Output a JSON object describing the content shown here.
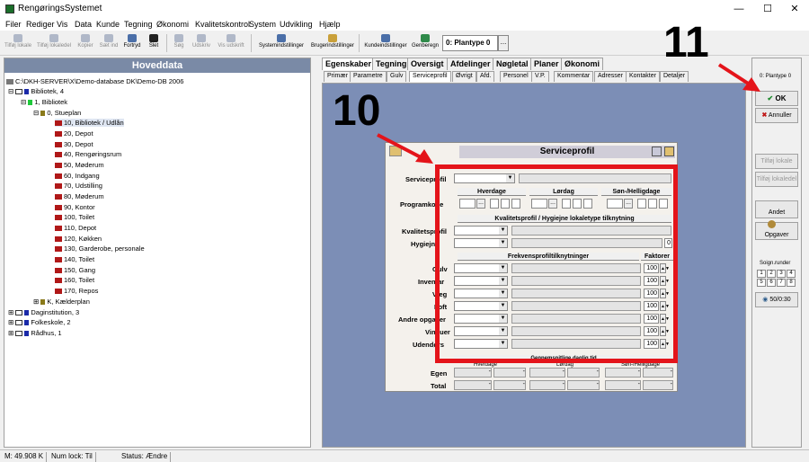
{
  "window": {
    "title": "RengøringsSystemet"
  },
  "menu": [
    "Filer",
    "Rediger",
    "Vis",
    "Data",
    "Kunde",
    "Tegning",
    "Økonomi",
    "Kvalitetskontrol",
    "System",
    "Udvikling",
    "Hjælp"
  ],
  "toolbar": {
    "buttons": [
      {
        "label": "Tilføj lokale"
      },
      {
        "label": "Tilføj lokaledel"
      },
      {
        "label": "Kopier"
      },
      {
        "label": "Sæt ind"
      },
      {
        "label": "Fortryd"
      },
      {
        "label": "Slet"
      },
      {
        "label": "Søg"
      },
      {
        "label": "Udskriv"
      },
      {
        "label": "Vis udskrift"
      },
      {
        "label": "Systemindstillinger"
      },
      {
        "label": "Brugerindstillinger"
      },
      {
        "label": "Kundeindstillinger"
      },
      {
        "label": "Genberegn"
      }
    ],
    "plantype": "0: Plantype 0",
    "more": "..."
  },
  "left": {
    "heading": "Hoveddata",
    "path": "C:\\DKH-SERVER\\X\\Demo-database DK\\Demo-DB 2006",
    "tree": [
      {
        "text": "Bibliotek, 4"
      },
      {
        "text": "1, Bibliotek"
      },
      {
        "text": "0, Stueplan"
      },
      {
        "text": "10, Bibliotek / Udlån"
      },
      {
        "text": "20, Depot"
      },
      {
        "text": "30, Depot"
      },
      {
        "text": "40, Rengøringsrum"
      },
      {
        "text": "50, Møderum"
      },
      {
        "text": "60, Indgang"
      },
      {
        "text": "70, Udstilling"
      },
      {
        "text": "80, Møderum"
      },
      {
        "text": "90, Kontor"
      },
      {
        "text": "100, Toilet"
      },
      {
        "text": "110, Depot"
      },
      {
        "text": "120, Køkken"
      },
      {
        "text": "130, Garderobe, personale"
      },
      {
        "text": "140, Toilet"
      },
      {
        "text": "150, Gang"
      },
      {
        "text": "160, Toilet"
      },
      {
        "text": "170, Repos"
      },
      {
        "text": "K, Kælderplan"
      },
      {
        "text": "Daginstitution, 3"
      },
      {
        "text": "Folkeskole, 2"
      },
      {
        "text": "Rådhus, 1"
      }
    ]
  },
  "tabs_main": [
    "Egenskaber",
    "Tegning",
    "Oversigt",
    "Afdelinger",
    "Nøgletal",
    "Planer",
    "Økonomi"
  ],
  "tabs_sub": [
    "Primær",
    "Parametre",
    "Gulv",
    "Serviceprofil",
    "Øvrigt",
    "Afd.",
    "Personel",
    "V.P.",
    "Kommentar",
    "Adresser",
    "Kontakter",
    "Detaljer"
  ],
  "form": {
    "title": "Serviceprofil",
    "labels": {
      "serviceprofil": "Serviceprofil",
      "programkode": "Programkode",
      "kvalitetsprofil": "Kvalitetsprofil",
      "hygiejne": "Hygiejne",
      "gulv": "Gulv",
      "inventar": "Inventar",
      "vaeg": "Væg",
      "loft": "Loft",
      "andre": "Andre opgaver",
      "vinduer": "Vinduer",
      "udendors": "Udendørs",
      "egen": "Egen",
      "total": "Total"
    },
    "headers": {
      "hverdage": "Hverdage",
      "lordag": "Lørdag",
      "sonhellig": "Søn-/Helligdage",
      "kvalitet": "Kvalitetsprofil / Hygiejne lokaletype tilknytning",
      "frekvens": "Frekvensprofiltilknytninger",
      "faktorer": "Faktorer",
      "gennemsnit": "Gennemsnitlige daglig tid",
      "hverdage2": "Hverdage",
      "lordag2": "Lørdag",
      "sonhellig2": "Søn-/Helligdage"
    },
    "hygiejne_value": "0",
    "factors": [
      "100",
      "100",
      "100",
      "100",
      "100",
      "100",
      "100"
    ],
    "dash": "-",
    "dots": "..."
  },
  "right": {
    "plantype": "0: Plantype 0",
    "ok": "OK",
    "cancel": "Annuller",
    "add_lokale": "Tilføj lokale",
    "add_lokaledel": "Tilføj lokaledel",
    "andet": "Andet",
    "opgaver": "Opgaver",
    "soign_label": "Soign.runder",
    "grid": [
      "1",
      "2",
      "3",
      "4",
      "5",
      "6",
      "7",
      "8"
    ],
    "time": "50/0:30"
  },
  "annotations": {
    "a10": "10",
    "a11": "11"
  },
  "status": {
    "memory": "M: 49.908 K",
    "numlock": "Num lock: Til",
    "status": "Status: Ændre"
  },
  "colors": {
    "workarea": "#7c8eb6",
    "highlight": "#e4141a",
    "header": "#7a8aa6"
  }
}
